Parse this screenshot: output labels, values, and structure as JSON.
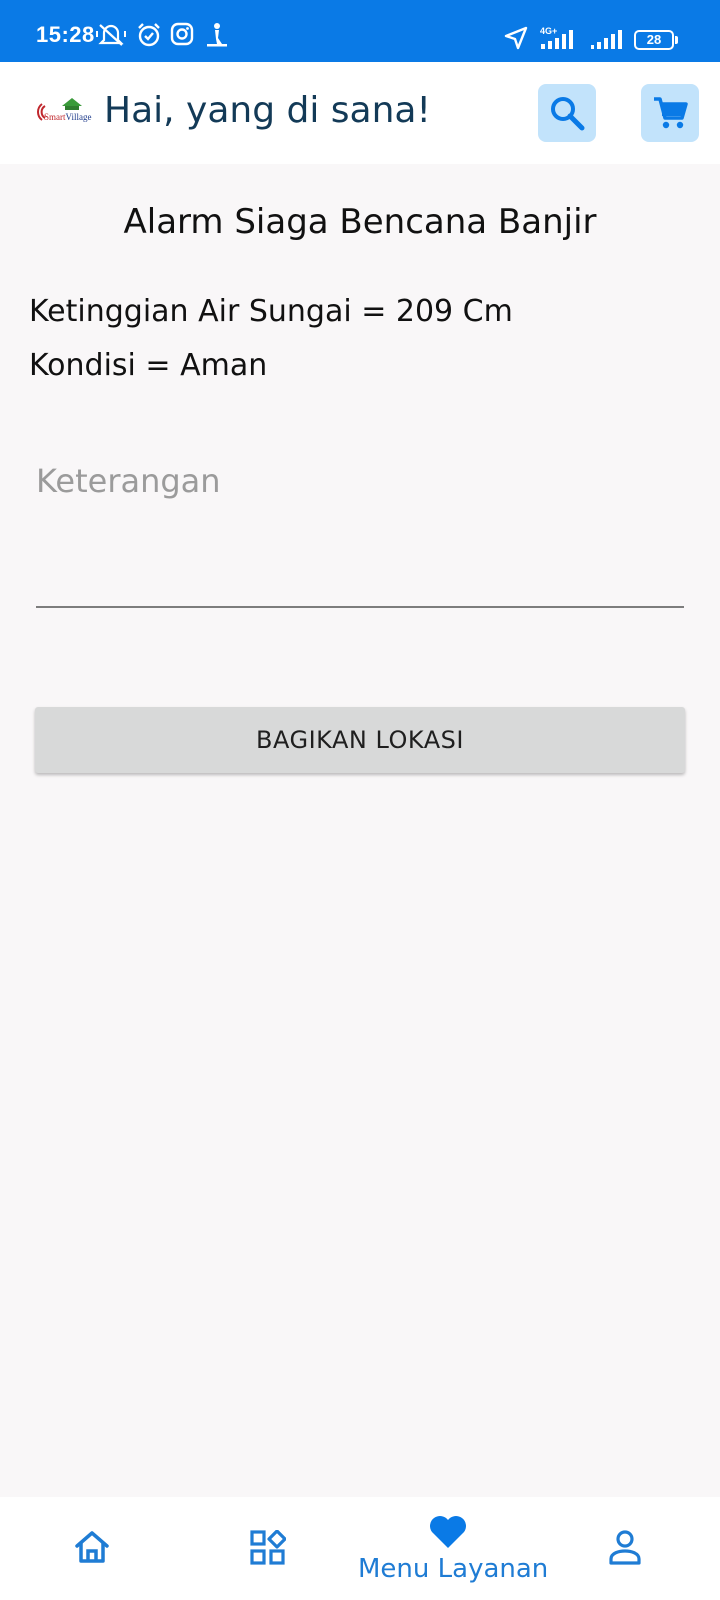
{
  "status_bar": {
    "time": "15:28",
    "network": "4G+",
    "battery": "28"
  },
  "header": {
    "logo_text_a": "Smart",
    "logo_text_b": "Village",
    "greeting": "Hai, yang di sana!",
    "search_icon": "search-icon",
    "cart_icon": "cart-icon"
  },
  "main": {
    "title": "Alarm Siaga Bencana Banjir",
    "water_level": "Ketinggian Air Sungai = 209 Cm",
    "condition": "Kondisi = Aman",
    "keterangan_placeholder": "Keterangan",
    "keterangan_value": "",
    "share_button": "BAGIKAN LOKASI"
  },
  "bottom_nav": {
    "items": [
      {
        "icon": "home-icon"
      },
      {
        "icon": "grid-icon"
      },
      {
        "icon": "heart-icon",
        "label": "Menu Layanan"
      },
      {
        "icon": "profile-icon"
      }
    ]
  },
  "colors": {
    "accent": "#0a7ae6",
    "icon_bg": "#c2e3fb",
    "greeting": "#133a57"
  }
}
